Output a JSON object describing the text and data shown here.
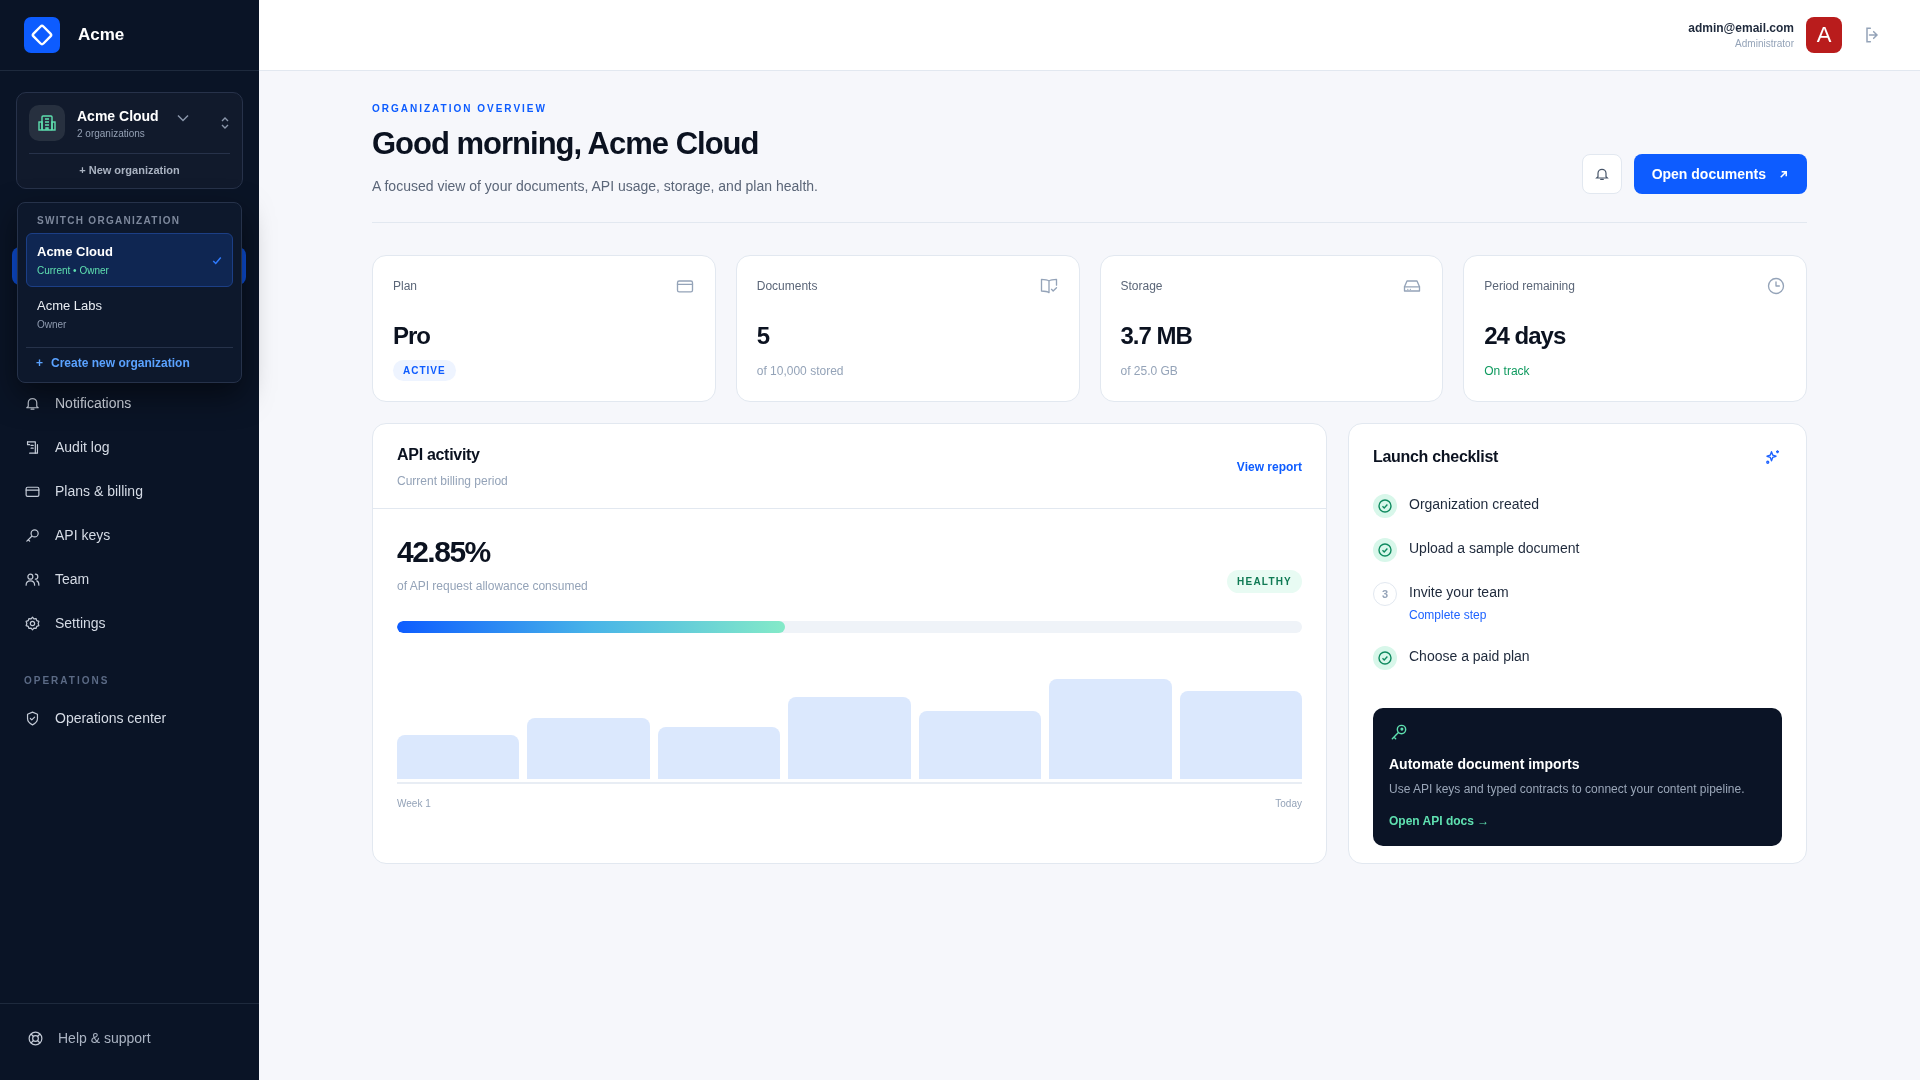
{
  "brand": {
    "name": "Acme"
  },
  "org_switcher": {
    "name": "Acme Cloud",
    "count": "2 organizations",
    "new_label": "+ New organization"
  },
  "org_menu": {
    "heading": "SWITCH ORGANIZATION",
    "items": [
      {
        "name": "Acme Cloud",
        "role": "Current • Owner",
        "selected": true
      },
      {
        "name": "Acme Labs",
        "role": "Owner",
        "selected": false
      }
    ],
    "create_icon": "+",
    "create_label": "Create new organization"
  },
  "sidebar": {
    "items": [
      {
        "label": "Notifications"
      },
      {
        "label": "Audit log"
      },
      {
        "label": "Plans & billing"
      },
      {
        "label": "API keys"
      },
      {
        "label": "Team"
      },
      {
        "label": "Settings"
      }
    ],
    "section": "OPERATIONS",
    "section_items": [
      {
        "label": "Operations center"
      }
    ],
    "help": "Help & support"
  },
  "user": {
    "email": "admin@email.com",
    "role": "Administrator",
    "initial": "A"
  },
  "page": {
    "eyebrow": "ORGANIZATION OVERVIEW",
    "title": "Good morning, Acme Cloud",
    "subtitle": "A focused view of your documents, API usage, storage, and plan health.",
    "primary_button": "Open documents"
  },
  "stats": [
    {
      "label": "Plan",
      "value": "Pro",
      "note": "ACTIVE",
      "kind": "badge"
    },
    {
      "label": "Documents",
      "value": "5",
      "note": "of 10,000 stored",
      "kind": "muted"
    },
    {
      "label": "Storage",
      "value": "3.7 MB",
      "note": "of 25.0 GB",
      "kind": "muted"
    },
    {
      "label": "Period remaining",
      "value": "24 days",
      "note": "On track",
      "kind": "good"
    }
  ],
  "api_activity": {
    "title": "API activity",
    "subtitle": "Current billing period",
    "link": "View report",
    "percent": "42.85%",
    "caption": "of API request allowance consumed",
    "status": "HEALTHY",
    "level": 0.4285,
    "x_start": "Week 1",
    "x_end": "Today"
  },
  "checklist": {
    "title": "Launch checklist",
    "items": [
      {
        "label": "Organization created",
        "done": true
      },
      {
        "label": "Upload a sample document",
        "done": true
      },
      {
        "label": "Invite your team",
        "done": false,
        "number": "3",
        "action": "Complete step"
      },
      {
        "label": "Choose a paid plan",
        "done": true
      }
    ],
    "promo": {
      "title": "Automate document imports",
      "text": "Use API keys and typed contracts to connect your content pipeline.",
      "link": "Open API docs →"
    }
  }
}
